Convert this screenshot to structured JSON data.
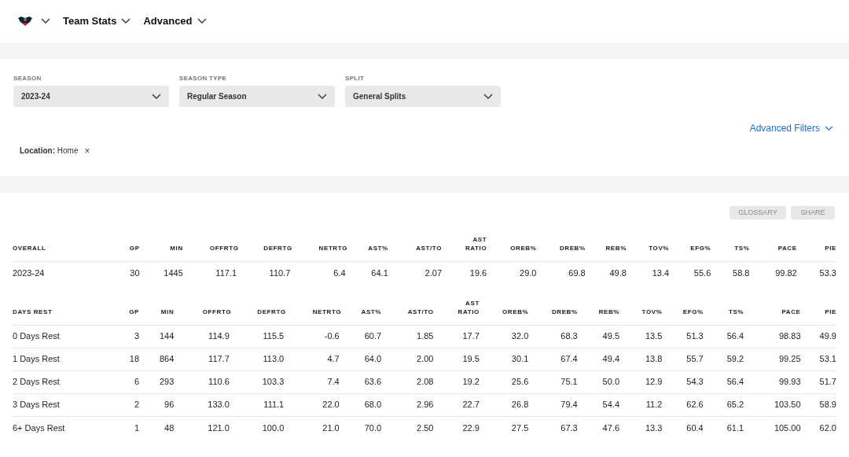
{
  "nav": {
    "menus": [
      {
        "label": "Team Stats"
      },
      {
        "label": "Advanced"
      }
    ]
  },
  "filters": [
    {
      "label": "SEASON",
      "value": "2023-24"
    },
    {
      "label": "SEASON TYPE",
      "value": "Regular Season"
    },
    {
      "label": "SPLIT",
      "value": "General Splits"
    }
  ],
  "advanced_filters": "Advanced Filters",
  "active_filters": [
    {
      "label": "Location:",
      "value": "Home",
      "remove": "×"
    }
  ],
  "buttons": [
    "GLOSSARY",
    "SHARE"
  ],
  "tables": [
    {
      "columns": [
        "OVERALL",
        "GP",
        "MIN",
        "OFFRTG",
        "DEFRTG",
        "NETRTG",
        "AST%",
        "AST/TO",
        "AST RATIO",
        "OREB%",
        "DREB%",
        "REB%",
        "TOV%",
        "EFG%",
        "TS%",
        "PACE",
        "PIE"
      ],
      "rows": [
        [
          "2023-24",
          "30",
          "1445",
          "117.1",
          "110.7",
          "6.4",
          "64.1",
          "2.07",
          "19.6",
          "29.0",
          "69.8",
          "49.8",
          "13.4",
          "55.6",
          "58.8",
          "99.82",
          "53.3"
        ]
      ]
    },
    {
      "columns": [
        "DAYS REST",
        "GP",
        "MIN",
        "OFFRTG",
        "DEFRTG",
        "NETRTG",
        "AST%",
        "AST/TO",
        "AST RATIO",
        "OREB%",
        "DREB%",
        "REB%",
        "TOV%",
        "EFG%",
        "TS%",
        "PACE",
        "PIE"
      ],
      "rows": [
        [
          "0 Days Rest",
          "3",
          "144",
          "114.9",
          "115.5",
          "-0.6",
          "60.7",
          "1.85",
          "17.7",
          "32.0",
          "68.3",
          "49.5",
          "13.5",
          "51.3",
          "56.4",
          "98.83",
          "49.9"
        ],
        [
          "1 Days Rest",
          "18",
          "864",
          "117.7",
          "113.0",
          "4.7",
          "64.0",
          "2.00",
          "19.5",
          "30.1",
          "67.4",
          "49.4",
          "13.8",
          "55.7",
          "59.2",
          "99.25",
          "53.1"
        ],
        [
          "2 Days Rest",
          "6",
          "293",
          "110.6",
          "103.3",
          "7.4",
          "63.6",
          "2.08",
          "19.2",
          "25.6",
          "75.1",
          "50.0",
          "12.9",
          "54.3",
          "56.4",
          "99.93",
          "51.7"
        ],
        [
          "3 Days Rest",
          "2",
          "96",
          "133.0",
          "111.1",
          "22.0",
          "68.0",
          "2.96",
          "22.7",
          "26.8",
          "79.4",
          "54.4",
          "11.2",
          "62.6",
          "65.2",
          "103.50",
          "58.9"
        ],
        [
          "6+ Days Rest",
          "1",
          "48",
          "121.0",
          "100.0",
          "21.0",
          "70.0",
          "2.50",
          "22.9",
          "27.5",
          "67.3",
          "47.6",
          "13.3",
          "60.4",
          "61.1",
          "105.00",
          "62.0"
        ]
      ]
    }
  ]
}
